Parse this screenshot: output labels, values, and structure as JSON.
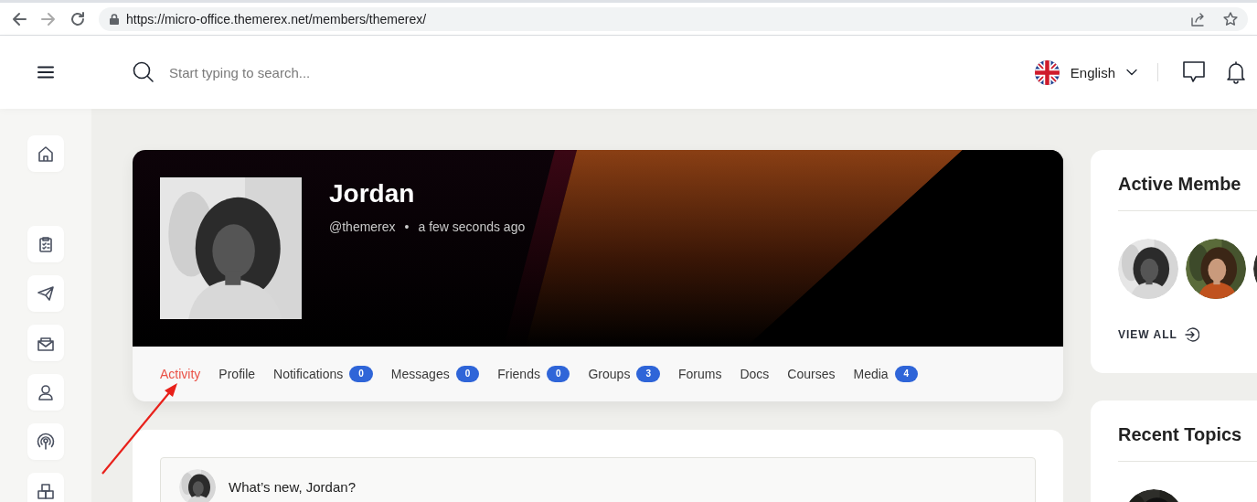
{
  "browser": {
    "url": "https://micro-office.themerex.net/members/themerex/"
  },
  "header": {
    "search": {
      "placeholder": "Start typing to search..."
    },
    "language": "English"
  },
  "profile": {
    "name": "Jordan",
    "handle": "@themerex",
    "separator": "•",
    "last_active": "a few seconds ago",
    "tabs": [
      {
        "label": "Activity",
        "selected": true
      },
      {
        "label": "Profile",
        "selected": false
      },
      {
        "label": "Notifications",
        "count": "0",
        "selected": false
      },
      {
        "label": "Messages",
        "count": "0",
        "selected": false
      },
      {
        "label": "Friends",
        "count": "0",
        "selected": false
      },
      {
        "label": "Groups",
        "count": "3",
        "selected": false
      },
      {
        "label": "Forums",
        "selected": false
      },
      {
        "label": "Docs",
        "selected": false
      },
      {
        "label": "Courses",
        "selected": false
      },
      {
        "label": "Media",
        "count": "4",
        "selected": false
      }
    ]
  },
  "composer": {
    "prompt": "What’s new, Jordan?"
  },
  "active_members": {
    "title": "Active Membe",
    "link": "VIEW ALL"
  },
  "recent_topics": {
    "title": "Recent Topics"
  }
}
